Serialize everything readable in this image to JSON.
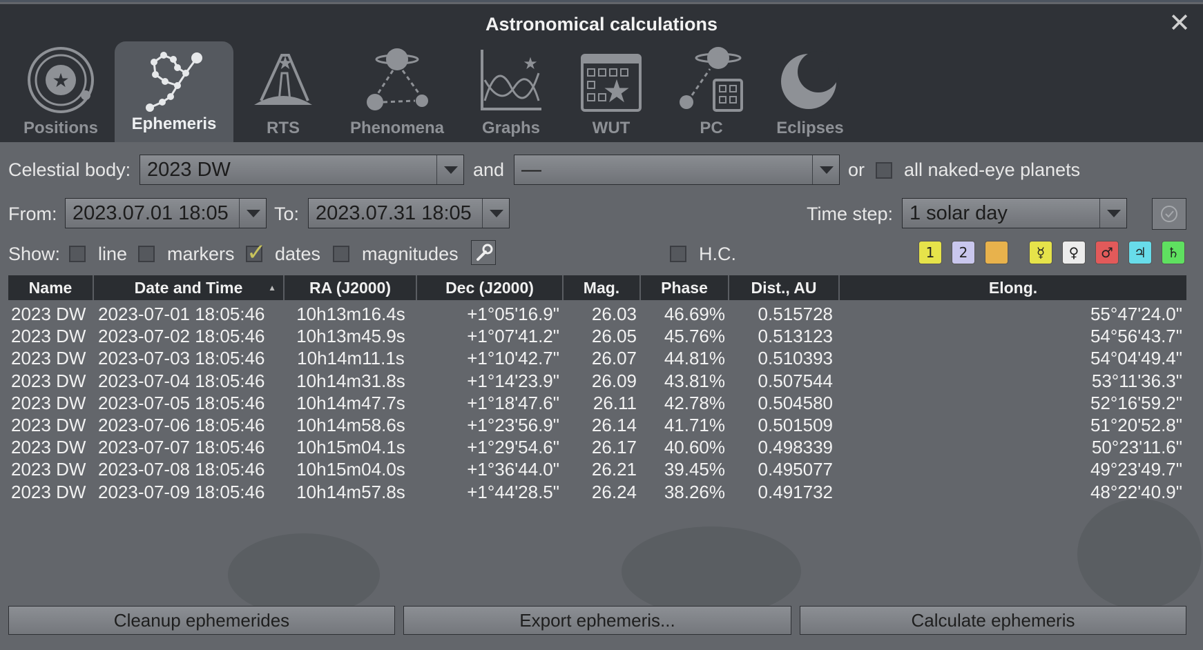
{
  "window": {
    "title": "Astronomical calculations"
  },
  "tabs": [
    {
      "label": "Positions",
      "icon": "positions-icon"
    },
    {
      "label": "Ephemeris",
      "icon": "ephemeris-icon",
      "active": true
    },
    {
      "label": "RTS",
      "icon": "rts-icon"
    },
    {
      "label": "Phenomena",
      "icon": "phenomena-icon"
    },
    {
      "label": "Graphs",
      "icon": "graphs-icon"
    },
    {
      "label": "WUT",
      "icon": "wut-icon"
    },
    {
      "label": "PC",
      "icon": "pc-icon"
    },
    {
      "label": "Eclipses",
      "icon": "eclipses-icon"
    }
  ],
  "controls": {
    "celestial_label": "Celestial body:",
    "celestial_value": "2023 DW",
    "and_label": "and",
    "second_value": "—",
    "or_label": "or",
    "naked_eye_label": "all naked-eye planets",
    "from_label": "From:",
    "from_value": "2023.07.01 18:05",
    "to_label": "To:",
    "to_value": "2023.07.31 18:05",
    "timestep_label": "Time step:",
    "timestep_value": "1 solar day",
    "show_label": "Show:",
    "line_label": "line",
    "markers_label": "markers",
    "dates_label": "dates",
    "magnitudes_label": "magnitudes",
    "hc_label": "H.C."
  },
  "planet_buttons": [
    {
      "label": "1",
      "color": "#e6e34a"
    },
    {
      "label": "2",
      "color": "#c9c7ee"
    },
    {
      "label": "",
      "color": "#e8b24c"
    },
    {
      "label": "☿",
      "color": "#e6e34a"
    },
    {
      "label": "♀",
      "color": "#ececec"
    },
    {
      "label": "♂",
      "color": "#e25a5a"
    },
    {
      "label": "♃",
      "color": "#68dcea"
    },
    {
      "label": "♄",
      "color": "#5fe060"
    }
  ],
  "table": {
    "headers": [
      "Name",
      "Date and Time",
      "RA (J2000)",
      "Dec (J2000)",
      "Mag.",
      "Phase",
      "Dist., AU",
      "Elong."
    ],
    "rows": [
      [
        "2023 DW",
        "2023-07-01 18:05:46",
        "10h13m16.4s",
        "+1°05'16.9\"",
        "26.03",
        "46.69%",
        "0.515728",
        "55°47'24.0\""
      ],
      [
        "2023 DW",
        "2023-07-02 18:05:46",
        "10h13m45.9s",
        "+1°07'41.2\"",
        "26.05",
        "45.76%",
        "0.513123",
        "54°56'43.7\""
      ],
      [
        "2023 DW",
        "2023-07-03 18:05:46",
        "10h14m11.1s",
        "+1°10'42.7\"",
        "26.07",
        "44.81%",
        "0.510393",
        "54°04'49.4\""
      ],
      [
        "2023 DW",
        "2023-07-04 18:05:46",
        "10h14m31.8s",
        "+1°14'23.9\"",
        "26.09",
        "43.81%",
        "0.507544",
        "53°11'36.3\""
      ],
      [
        "2023 DW",
        "2023-07-05 18:05:46",
        "10h14m47.7s",
        "+1°18'47.6\"",
        "26.11",
        "42.78%",
        "0.504580",
        "52°16'59.2\""
      ],
      [
        "2023 DW",
        "2023-07-06 18:05:46",
        "10h14m58.6s",
        "+1°23'56.9\"",
        "26.14",
        "41.71%",
        "0.501509",
        "51°20'52.8\""
      ],
      [
        "2023 DW",
        "2023-07-07 18:05:46",
        "10h15m04.1s",
        "+1°29'54.6\"",
        "26.17",
        "40.60%",
        "0.498339",
        "50°23'11.6\""
      ],
      [
        "2023 DW",
        "2023-07-08 18:05:46",
        "10h15m04.0s",
        "+1°36'44.0\"",
        "26.21",
        "39.45%",
        "0.495077",
        "49°23'49.7\""
      ],
      [
        "2023 DW",
        "2023-07-09 18:05:46",
        "10h14m57.8s",
        "+1°44'28.5\"",
        "26.24",
        "38.26%",
        "0.491732",
        "48°22'40.9\""
      ]
    ]
  },
  "buttons": {
    "cleanup": "Cleanup ephemerides",
    "export": "Export ephemeris...",
    "calculate": "Calculate ephemeris"
  }
}
